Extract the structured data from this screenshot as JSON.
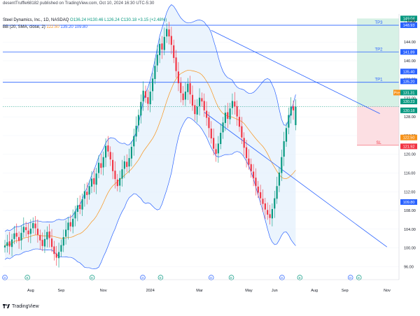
{
  "header": {
    "published": "desentTruffle68182 published on TradingView.com, Oct 10, 2024 16:30 UTC-5:30"
  },
  "symbol": {
    "name": "Steel Dynamics, Inc., 1D, NASDAQ",
    "o": "O136.24",
    "h": "H130.46",
    "l": "L126.24",
    "c": "C130.18",
    "chg": "+3.15 (+2.48%)"
  },
  "indicator": {
    "label": "BB (20, SMA, close, 2)",
    "basis": "122.50",
    "upper": "135.20",
    "lower": "109.80"
  },
  "currency": "USD",
  "footer": {
    "brand": "TradingView"
  },
  "colors": {
    "up": "#089981",
    "down": "#f23645",
    "basis": "#f7931a",
    "band": "#2962ff",
    "bandFill": "#e3effc",
    "level": "#2962ff",
    "targetFill": "#d7f1e6",
    "stopFill": "#fcdfe3"
  },
  "chart_data": {
    "type": "candlestick",
    "ylim": [
      95,
      150
    ],
    "y_ticks": [
      "96.00",
      "100.00",
      "104.00",
      "108.00",
      "112.00",
      "116.00",
      "120.00",
      "124.00",
      "128.00",
      "132.00",
      "136.00",
      "140.00",
      "144.00",
      "148.00"
    ],
    "x_ticks": [
      "Aug",
      "Sep",
      "Nov",
      "2024",
      "Mar",
      "May",
      "Jun",
      "Aug",
      "Sep",
      "Nov"
    ],
    "price_labels": [
      {
        "text": "149.04",
        "value": 149.04,
        "color": "#089981"
      },
      {
        "text": "148.93",
        "value": 147.6,
        "color": "#2962ff"
      },
      {
        "text": "141.89",
        "value": 141.89,
        "color": "#2962ff"
      },
      {
        "text": "135.40",
        "value": 137.7,
        "color": "#2962ff"
      },
      {
        "text": "135.20",
        "value": 135.6,
        "color": "#2962ff"
      },
      {
        "text": "131.31",
        "value": 133.2,
        "color": "#089981"
      },
      {
        "text": "Pre",
        "value": 133.2,
        "color": "#f7931a"
      },
      {
        "text": "130.23",
        "value": 131.3,
        "color": "#089981"
      },
      {
        "text": "130.18",
        "value": 129.4,
        "color": "#089981"
      },
      {
        "text": "122.50",
        "value": 123.6,
        "color": "#f7931a"
      },
      {
        "text": "121.92",
        "value": 121.7,
        "color": "#f23645"
      },
      {
        "text": "109.80",
        "value": 109.8,
        "color": "#2962ff"
      }
    ],
    "levels": [
      {
        "label": "TP3",
        "value": 147.6
      },
      {
        "label": "TP2",
        "value": 141.89
      },
      {
        "label": "TP1",
        "value": 135.4
      },
      {
        "label": "SL",
        "value": 121.92
      }
    ],
    "entry": 130.23,
    "channel": {
      "upper": [
        {
          "i": 85,
          "v": 146.5
        },
        {
          "i": 142,
          "v": 127.5
        }
      ],
      "lower": [
        {
          "i": 82,
          "v": 129
        },
        {
          "i": 145,
          "v": 99
        }
      ]
    },
    "event_icons": [
      "D",
      "E",
      "E",
      "D",
      "E",
      "D",
      "E",
      "D",
      "E",
      "D",
      "E"
    ],
    "events": [
      {
        "i": 0,
        "t": "D"
      },
      {
        "i": 9,
        "t": "E"
      },
      {
        "i": 36,
        "t": "E"
      },
      {
        "i": 57,
        "t": "D"
      },
      {
        "i": 64,
        "t": "E"
      },
      {
        "i": 85,
        "t": "D"
      },
      {
        "i": 93,
        "t": "E"
      },
      {
        "i": 114,
        "t": "D"
      },
      {
        "i": 121,
        "t": "E"
      },
      {
        "i": 142,
        "t": "D"
      },
      {
        "i": 145,
        "t": "E"
      }
    ],
    "candles_close": [
      100.5,
      101.2,
      100.3,
      101.8,
      103.1,
      102.4,
      101.5,
      103.2,
      104.5,
      103.8,
      102.9,
      104.1,
      105.3,
      104.2,
      102.8,
      101.6,
      100.4,
      101.9,
      103.4,
      102.1,
      100.2,
      98.7,
      97.9,
      99.1,
      100.6,
      102.3,
      103.9,
      105.4,
      104.6,
      106.2,
      107.8,
      109.1,
      108.3,
      110.4,
      112.1,
      111.3,
      113.2,
      114.8,
      113.6,
      115.9,
      118.2,
      117.1,
      119.4,
      121.8,
      120.6,
      118.9,
      116.4,
      114.7,
      113.2,
      114.9,
      116.8,
      118.5,
      117.3,
      119.2,
      121.6,
      123.9,
      126.1,
      128.4,
      131.2,
      133.6,
      132.1,
      130.8,
      133.4,
      136.2,
      138.9,
      141.3,
      143.6,
      142.4,
      145.1,
      146.8,
      145.2,
      143.4,
      140.6,
      137.8,
      135.2,
      133.1,
      131.6,
      133.4,
      135.1,
      132.8,
      130.4,
      128.6,
      130.2,
      132.1,
      131.3,
      129.4,
      127.8,
      125.6,
      123.4,
      121.2,
      120.1,
      122.3,
      124.6,
      126.8,
      128.9,
      127.6,
      129.8,
      131.4,
      130.2,
      128.1,
      125.9,
      123.6,
      121.4,
      119.2,
      117.8,
      116.4,
      114.9,
      113.2,
      111.8,
      110.6,
      109.4,
      108.2,
      107.1,
      106.4,
      108.3,
      110.6,
      113.2,
      116.1,
      119.4,
      122.8,
      125.6,
      128.4,
      130.2,
      129.4,
      130.18
    ],
    "candles_open": [
      100.1,
      100.4,
      101.4,
      100.2,
      101.9,
      103.2,
      102.3,
      101.6,
      103.3,
      104.4,
      103.7,
      103.0,
      104.2,
      105.2,
      104.1,
      102.7,
      101.7,
      100.3,
      101.8,
      103.5,
      102.0,
      100.3,
      98.8,
      97.8,
      99.2,
      100.5,
      102.4,
      103.8,
      105.5,
      104.5,
      106.3,
      107.7,
      109.2,
      108.2,
      110.5,
      112.0,
      111.4,
      113.1,
      114.9,
      113.5,
      116.0,
      118.1,
      117.2,
      119.3,
      121.9,
      120.5,
      118.8,
      116.5,
      114.6,
      113.3,
      114.8,
      116.9,
      118.4,
      117.4,
      119.1,
      121.7,
      123.8,
      126.2,
      128.3,
      131.3,
      133.5,
      132.2,
      130.7,
      133.5,
      136.1,
      139.0,
      141.2,
      143.7,
      142.3,
      145.2,
      146.7,
      145.3,
      143.3,
      140.7,
      137.7,
      135.3,
      133.0,
      131.7,
      133.3,
      135.2,
      132.7,
      130.5,
      128.5,
      130.3,
      132.0,
      131.4,
      129.3,
      127.9,
      125.5,
      123.5,
      121.1,
      120.2,
      122.2,
      124.7,
      126.7,
      129.0,
      127.5,
      129.9,
      131.3,
      130.3,
      128.0,
      126.0,
      123.5,
      121.5,
      119.1,
      117.9,
      116.3,
      115.0,
      113.1,
      111.9,
      110.5,
      109.5,
      108.1,
      107.2,
      106.3,
      108.4,
      110.5,
      113.3,
      116.0,
      119.5,
      122.7,
      125.7,
      128.3,
      130.3,
      126.24
    ]
  }
}
